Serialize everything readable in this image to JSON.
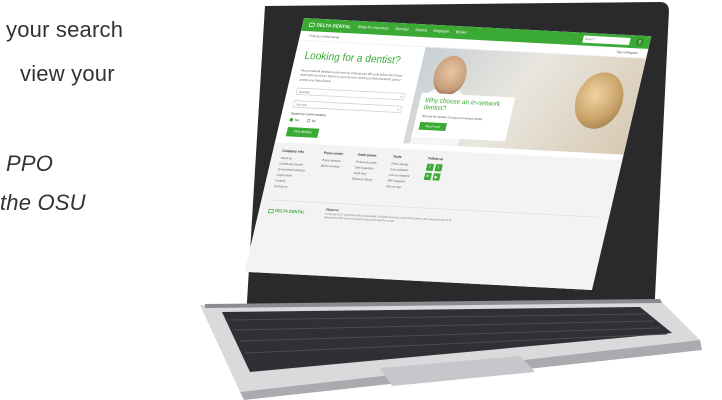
{
  "background_copy": {
    "line1": "your search",
    "line2": "view your",
    "line3": "PPO",
    "line4": "the OSU"
  },
  "site": {
    "brand": "DELTA DENTAL",
    "nav": [
      "Shop for insurance",
      "Member",
      "Dentist",
      "Employer",
      "Broker"
    ],
    "search_placeholder": "Search",
    "subbar_left": "Find your Delta Dental",
    "subbar_right": "Sign in/Register"
  },
  "hero": {
    "title": "Looking for a dentist?",
    "description": "Find in-network dentists in your area by entering your ZIP code below. Don't know which plan you have? Sign in to your account, check your Delta Dental ID card or contact your Delta Dental.",
    "field1": "Specialty",
    "field2": "Your plan",
    "search_location_label": "Search by current location:",
    "radio_yes": "Yes",
    "radio_no": "No",
    "find_button": "Find dentists"
  },
  "promo": {
    "title": "Why choose an in-network dentist?",
    "description": "Here are the benefits of using an in-network dentist.",
    "button": "Read more"
  },
  "footer": {
    "columns": [
      {
        "title": "Company info",
        "items": [
          "About us",
          "Community benefit",
          "Government relations",
          "Legal center",
          "Careers",
          "Contact us"
        ]
      },
      {
        "title": "Press center",
        "items": [
          "Press releases",
          "Media contacts"
        ]
      },
      {
        "title": "Smile power",
        "items": [
          "Protect my smile",
          "Grin! magazine",
          "Tooth fairy",
          "Resource library"
        ]
      },
      {
        "title": "Tools",
        "items": [
          "Find a dentist",
          "Cost estimator",
          "Join our network",
          "RFP assistant",
          "Get our app"
        ]
      },
      {
        "title": "Follow us",
        "items": []
      }
    ],
    "about_title": "About us",
    "about_text": "© Copyright 2017 Delta Dental Plans Association. All Rights Reserved. Delta Dental refers to the national network of 39 independent Delta Dental companies that provide dental coverage.",
    "brand": "DELTA DENTAL"
  },
  "colors": {
    "brand_green": "#3aaa35"
  }
}
